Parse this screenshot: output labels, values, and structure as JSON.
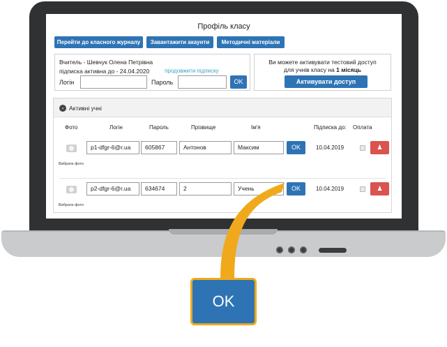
{
  "colors": {
    "accent": "#2e74b5",
    "danger": "#d9534f",
    "callout_border": "#f0a91c",
    "link": "#3aa3c4"
  },
  "page": {
    "title": "Профіль класу"
  },
  "toolbar": {
    "journal_label": "Перейти до класного журналу",
    "download_label": "Завантажити акаунти",
    "materials_label": "Методичні матеріали"
  },
  "teacher": {
    "name_line": "Вчитель - Шевчук Олена Петрівна",
    "subscription_line": "підписка активна до - 24.04.2020",
    "extend_link": "продовжити підписку",
    "login_label": "Логін",
    "login_value": "",
    "password_label": "Пароль",
    "password_value": "",
    "ok_label": "OK"
  },
  "trial": {
    "text_line1": "Ви можете активувати тестовий доступ",
    "text_line2_prefix": "для учнів класу на",
    "text_line2_bold": "1 місяць",
    "activate_label": "Активувати доступ"
  },
  "students": {
    "section_title": "Активні учні",
    "columns": [
      "Фото",
      "Логін",
      "Пароль",
      "Прізвище",
      "Ім'я",
      "Підписка до:",
      "Оплата"
    ],
    "photo_caption": "Вибрати фото",
    "rows": [
      {
        "login": "p1-dfgr-6@r.ua",
        "password": "605867",
        "surname": "Антонов",
        "name": "Максим",
        "ok": "OK",
        "until": "10.04.2019",
        "pay_icon": "person-icon"
      },
      {
        "login": "p2-dfgr-6@r.ua",
        "password": "634674",
        "surname": "2",
        "name": "Учень",
        "ok": "OK",
        "until": "10.04.2019",
        "pay_icon": "person-icon"
      }
    ]
  },
  "callout": {
    "label": "OK"
  }
}
